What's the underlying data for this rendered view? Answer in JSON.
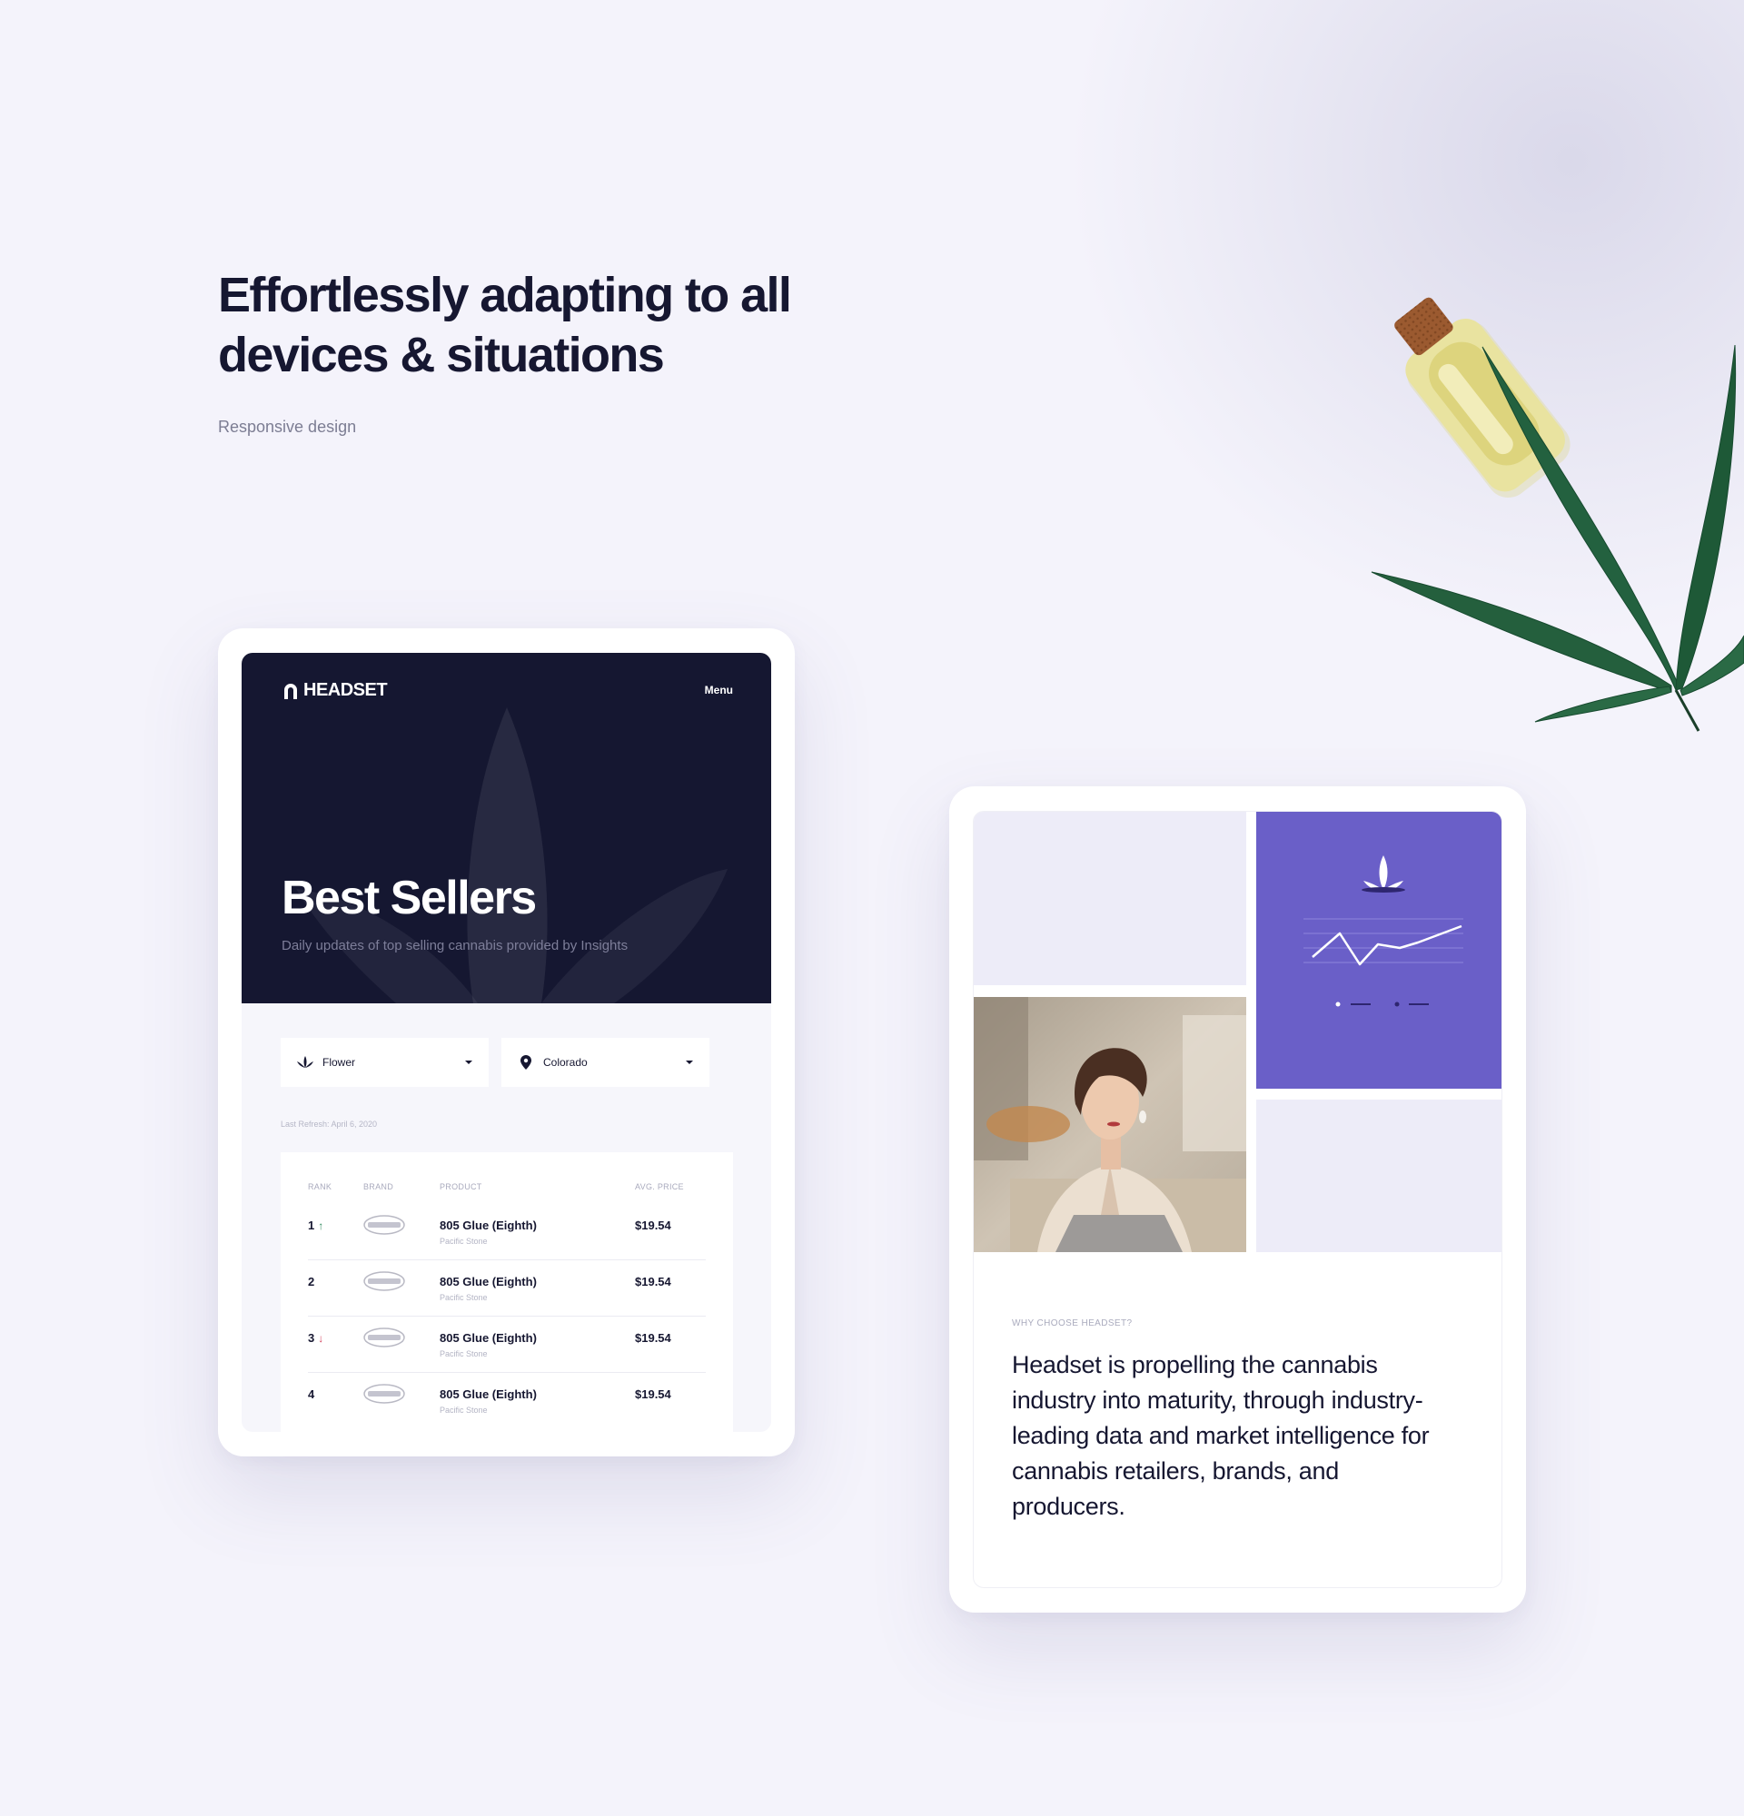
{
  "hero": {
    "title": "Effortlessly adapting to all devices & situations",
    "subtitle": "Responsive design"
  },
  "tablet1": {
    "logo_text": "HEADSET",
    "menu_label": "Menu",
    "title": "Best Sellers",
    "subtitle": "Daily updates of top selling cannabis provided by Insights",
    "filters": {
      "category": "Flower",
      "location": "Colorado"
    },
    "refresh_text": "Last Refresh: April 6, 2020",
    "table": {
      "headers": [
        "RANK",
        "BRAND",
        "PRODUCT",
        "AVG. PRICE"
      ],
      "rows": [
        {
          "rank": "1",
          "arrow": "↑",
          "trend": "up",
          "product": "805 Glue (Eighth)",
          "brand": "Pacific Stone",
          "price": "$19.54"
        },
        {
          "rank": "2",
          "arrow": "",
          "trend": "none",
          "product": "805 Glue (Eighth)",
          "brand": "Pacific Stone",
          "price": "$19.54"
        },
        {
          "rank": "3",
          "arrow": "↓",
          "trend": "down",
          "product": "805 Glue (Eighth)",
          "brand": "Pacific Stone",
          "price": "$19.54"
        },
        {
          "rank": "4",
          "arrow": "",
          "trend": "none",
          "product": "805 Glue (Eighth)",
          "brand": "Pacific Stone",
          "price": "$19.54"
        }
      ]
    }
  },
  "tablet2": {
    "why_label": "WHY CHOOSE HEADSET?",
    "why_text": "Headset is propelling the cannabis industry into maturity, through industry-leading data and market intelligence for cannabis retailers, brands, and producers."
  },
  "colors": {
    "navy": "#151731",
    "purple": "#6a5fc8",
    "lavender": "#edecf8",
    "background": "#f4f3fb",
    "up": "#2f8a5d",
    "down": "#d3415c"
  },
  "icons": {
    "logo": "headset-logo-icon",
    "flower": "cannabis-leaf-icon",
    "location": "map-pin-icon",
    "caret": "caret-down-icon"
  }
}
